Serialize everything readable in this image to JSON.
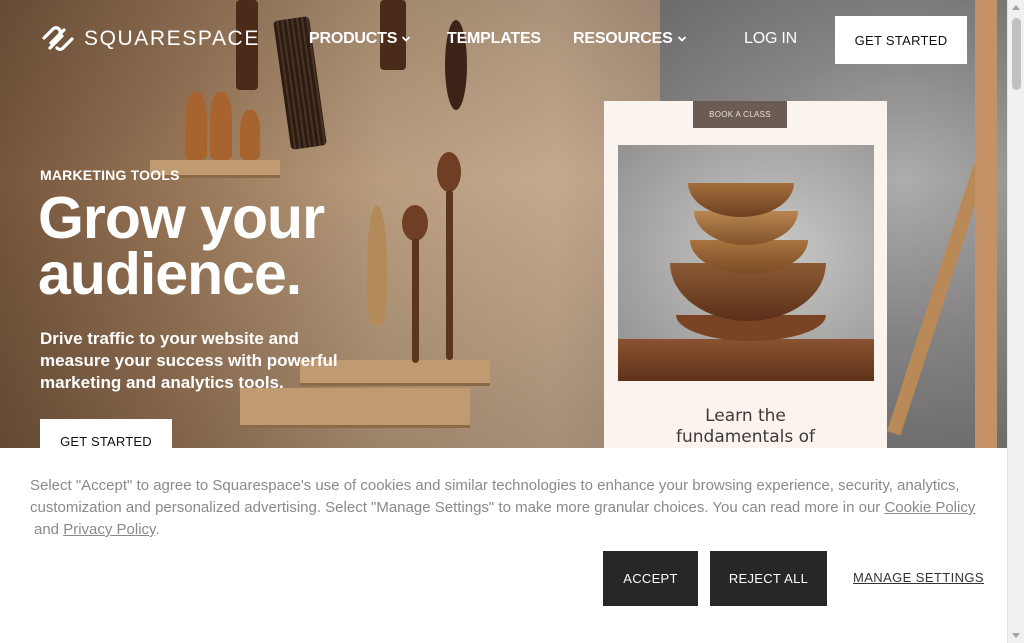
{
  "nav": {
    "logo_text": "SQUARESPACE",
    "items": [
      {
        "label": "PRODUCTS",
        "has_dropdown": true
      },
      {
        "label": "TEMPLATES",
        "has_dropdown": false
      },
      {
        "label": "RESOURCES",
        "has_dropdown": true
      }
    ],
    "login_label": "LOG IN",
    "get_started_label": "GET STARTED"
  },
  "hero": {
    "eyebrow": "MARKETING TOOLS",
    "headline": "Grow your audience.",
    "subcopy": "Drive traffic to your website and measure your success with powerful marketing and analytics tools.",
    "cta_label": "GET STARTED"
  },
  "preview_card": {
    "badge": "BOOK A CLASS",
    "title": "Learn the fundamentals of"
  },
  "cookie_banner": {
    "text_before": "Select \"Accept\" to agree to Squarespace's use of cookies and similar technologies to enhance your browsing experience, security, analytics, customization and personalized advertising. Select \"Manage Settings\" to make more granular choices. You can read more in our ",
    "cookie_policy_link": "Cookie Policy",
    "text_and": " and ",
    "privacy_policy_link": "Privacy Policy",
    "text_end": ".",
    "accept_label": "ACCEPT",
    "reject_label": "REJECT ALL",
    "manage_label": "MANAGE SETTINGS"
  },
  "icons": {
    "logo": "squarespace-logo-icon",
    "dropdown": "chevron-down-icon"
  },
  "colors": {
    "button_dark": "#272727",
    "cookie_text": "#8a8a8a",
    "card_background": "#fbf3ee",
    "card_badge": "#6a5b53"
  }
}
